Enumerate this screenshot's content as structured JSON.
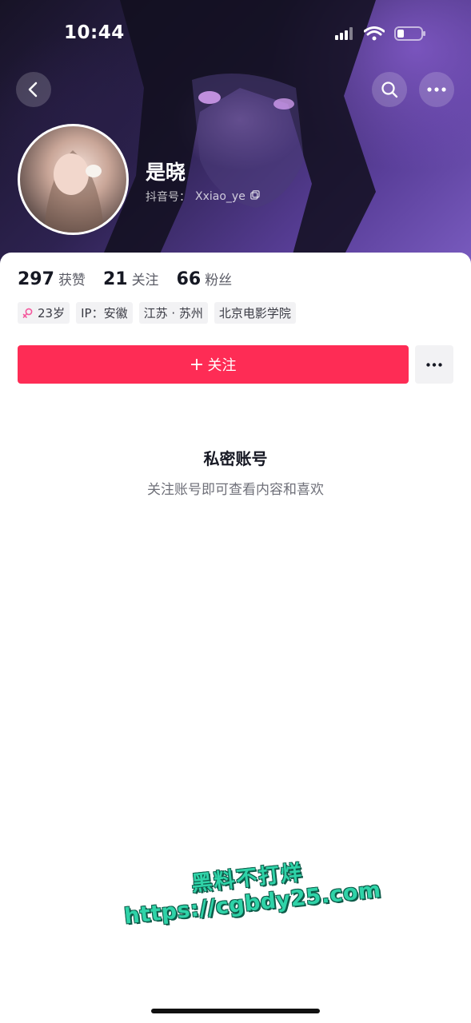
{
  "status_bar": {
    "time": "10:44",
    "icons": [
      "signal-icon",
      "wifi-icon",
      "battery-icon"
    ]
  },
  "header": {
    "buttons": [
      "back-icon",
      "search-icon",
      "more-icon"
    ]
  },
  "profile": {
    "name": "是晓",
    "id_label": "抖音号：",
    "id_value": "Xxiao_ye",
    "stats": [
      {
        "value": "297",
        "label": "获赞"
      },
      {
        "value": "21",
        "label": "关注"
      },
      {
        "value": "66",
        "label": "粉丝"
      }
    ],
    "tags": {
      "age": "23岁",
      "ip": "IP：安徽",
      "location": "江苏 · 苏州",
      "school": "北京电影学院"
    },
    "follow_button": "关注"
  },
  "private": {
    "title": "私密账号",
    "subtitle": "关注账号即可查看内容和喜欢"
  },
  "watermark": {
    "line1": "黑料不打烊",
    "line2": "https://cgbdy25.com"
  },
  "colors": {
    "accent": "#fe2c55",
    "female_icon": "#f4579c",
    "watermark": "#2fd3a8"
  }
}
